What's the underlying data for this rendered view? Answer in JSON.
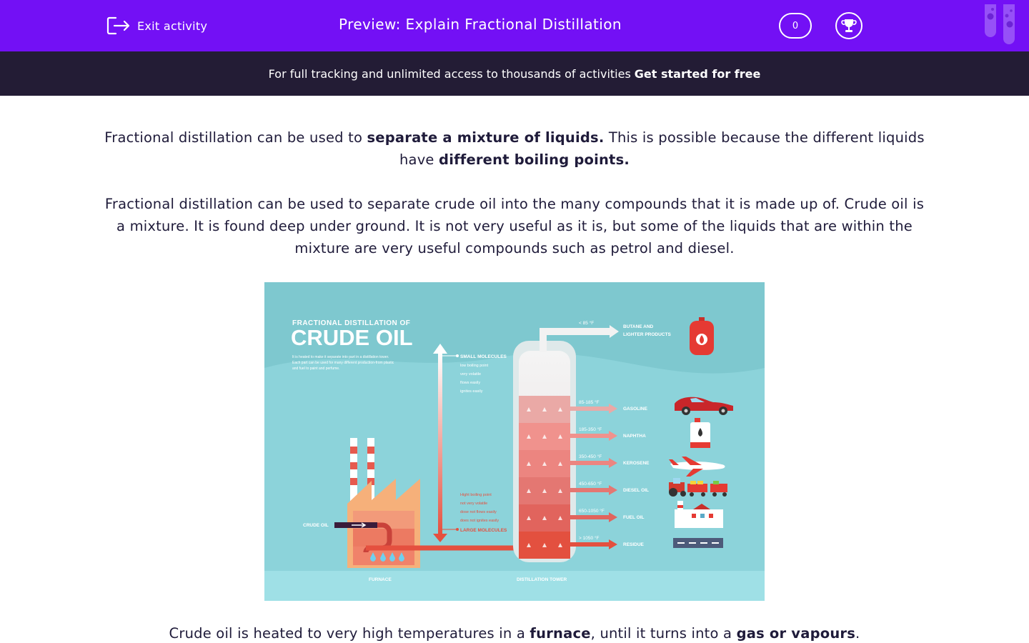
{
  "header": {
    "exit_label": "Exit activity",
    "title": "Preview: Explain Fractional Distillation",
    "score": "0"
  },
  "banner": {
    "text": "For full tracking and unlimited access to thousands of activities",
    "cta": "Get started for free"
  },
  "content": {
    "p1": {
      "a": "Fractional distillation can be used to ",
      "b": "separate a mixture of liquids.",
      "c": " This is possible because the different liquids have ",
      "d": "different boiling points."
    },
    "p2": "Fractional distillation can be used to separate crude oil into the many compounds that it is made up of. Crude oil is a mixture. It is found deep under ground. It is not very useful as it is, but some of the liquids that are within the mixture are very useful compounds such as petrol and diesel.",
    "p3": {
      "a": "Crude oil is heated to very high temperatures in a ",
      "b": "furnace",
      "c": ", until it turns into a ",
      "d": "gas or vapours",
      "e": "."
    }
  },
  "infographic": {
    "title_small": "FRACTIONAL DISTILLATION OF",
    "title_big": "CRUDE OIL",
    "desc": [
      "It is heated to make it separate into part in a distillation tower.",
      "Each part can be used for many different production-from plastic",
      "and fuel to paint and perfume."
    ],
    "small_molecules": "SMALL MOLECULES",
    "small_props": [
      "low boiling point",
      "very volatile",
      "flows easily",
      "ignites easily"
    ],
    "large_molecules": "LARGE MOLECULES",
    "large_props": [
      "Hight boiling point",
      "not very volatile",
      "dose not flows easily",
      "does not ignites easily"
    ],
    "crude_oil_label": "CRUDE OIL",
    "furnace_label": "FURNACE",
    "tower_label": "DISTILLATION TOWER",
    "top_product": {
      "temp": "< 85 °F",
      "name_line1": "BUTANE AND",
      "name_line2": "LIGHTER PRODUCTS"
    },
    "fractions": [
      {
        "temp": "85-185 °F",
        "name": "GASOLINE",
        "color": "#eaa9a6"
      },
      {
        "temp": "185-350 °F",
        "name": "NAPHTHA",
        "color": "#f0928d"
      },
      {
        "temp": "350-450 °F",
        "name": "KEROSENE",
        "color": "#ec8580"
      },
      {
        "temp": "450-650 °F",
        "name": "DIESEL OIL",
        "color": "#e47772"
      },
      {
        "temp": "650-1050 °F",
        "name": "FUEL OIL",
        "color": "#e1645d"
      },
      {
        "temp": "> 1050 °F",
        "name": "RESIDUE",
        "color": "#e3503f"
      }
    ]
  },
  "colors": {
    "header_purple": "#7310f5",
    "banner_dark": "#231c35",
    "teal_bg": "#8cd3da",
    "arrow_red": "#e65a4e"
  }
}
